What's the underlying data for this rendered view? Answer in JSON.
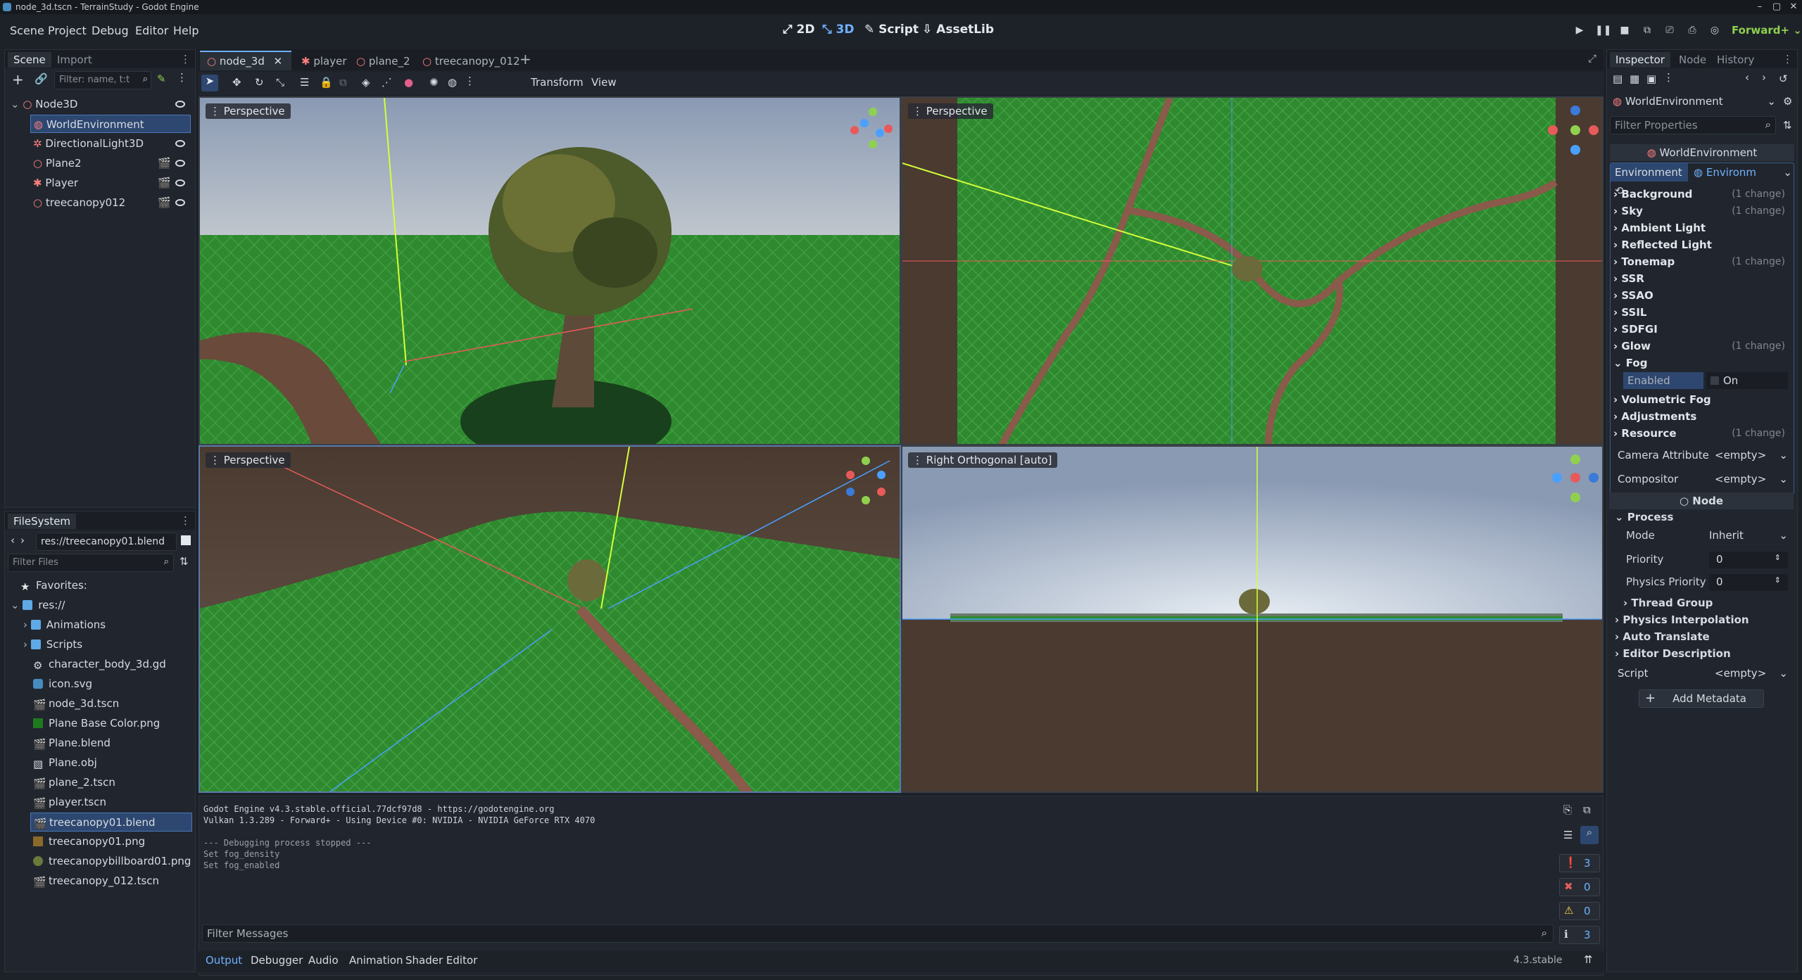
{
  "window": {
    "title": "node_3d.tscn - TerrainStudy - Godot Engine"
  },
  "menubar": {
    "items": [
      "Scene",
      "Project",
      "Debug",
      "Editor",
      "Help"
    ],
    "workspaces": [
      "2D",
      "3D",
      "Script",
      "AssetLib"
    ],
    "renderer": "Forward+"
  },
  "scene_dock": {
    "tabs": [
      "Scene",
      "Import"
    ],
    "filter_placeholder": "Filter: name, t:t",
    "nodes": [
      {
        "label": "Node3D"
      },
      {
        "label": "WorldEnvironment"
      },
      {
        "label": "DirectionalLight3D"
      },
      {
        "label": "Plane2"
      },
      {
        "label": "Player"
      },
      {
        "label": "treecanopy012"
      }
    ]
  },
  "filesystem": {
    "title": "FileSystem",
    "path": "res://treecanopy01.blend",
    "filter_placeholder": "Filter Files",
    "favorites": "Favorites:",
    "root": "res://",
    "items": [
      "Animations",
      "Scripts",
      "character_body_3d.gd",
      "icon.svg",
      "node_3d.tscn",
      "Plane Base Color.png",
      "Plane.blend",
      "Plane.obj",
      "plane_2.tscn",
      "player.tscn",
      "treecanopy01.blend",
      "treecanopy01.png",
      "treecanopybillboard01.png",
      "treecanopy_012.tscn"
    ]
  },
  "editor_tabs": [
    "node_3d",
    "player",
    "plane_2",
    "treecanopy_012"
  ],
  "toolbar": {
    "transform": "Transform",
    "view": "View"
  },
  "viewports": {
    "top_left": "Perspective",
    "top_right": "Perspective",
    "bottom_left": "Perspective",
    "bottom_right": "Right Orthogonal [auto]"
  },
  "output": {
    "lines": [
      "Godot Engine v4.3.stable.official.77dcf97d8 - https://godotengine.org",
      "Vulkan 1.3.289 - Forward+ - Using Device #0: NVIDIA - NVIDIA GeForce RTX 4070",
      "",
      "--- Debugging process stopped ---",
      "Set fog_density",
      "Set fog_enabled"
    ],
    "filter_placeholder": "Filter Messages",
    "counts": [
      "3",
      "0",
      "0",
      "3"
    ],
    "bottom_tabs": [
      "Output",
      "Debugger",
      "Audio",
      "Animation",
      "Shader Editor"
    ],
    "version": "4.3.stable"
  },
  "inspector": {
    "tabs": [
      "Inspector",
      "Node",
      "History"
    ],
    "object": "WorldEnvironment",
    "filter_placeholder": "Filter Properties",
    "header": "WorldEnvironment",
    "env_label": "Environment",
    "env_value": "Environm",
    "sections": [
      {
        "name": "Background",
        "change": "(1 change)"
      },
      {
        "name": "Sky",
        "change": "(1 change)"
      },
      {
        "name": "Ambient Light",
        "change": ""
      },
      {
        "name": "Reflected Light",
        "change": ""
      },
      {
        "name": "Tonemap",
        "change": "(1 change)"
      },
      {
        "name": "SSR",
        "change": ""
      },
      {
        "name": "SSAO",
        "change": ""
      },
      {
        "name": "SSIL",
        "change": ""
      },
      {
        "name": "SDFGI",
        "change": ""
      },
      {
        "name": "Glow",
        "change": "(1 change)"
      },
      {
        "name": "Fog",
        "change": ""
      }
    ],
    "fog_enabled_label": "Enabled",
    "fog_enabled_value": "On",
    "sections2": [
      {
        "name": "Volumetric Fog",
        "change": ""
      },
      {
        "name": "Adjustments",
        "change": ""
      },
      {
        "name": "Resource",
        "change": "(1 change)"
      }
    ],
    "camera_attr": "Camera Attribute",
    "compositor": "Compositor",
    "empty": "<empty>",
    "node_header": "Node",
    "process": "Process",
    "mode_label": "Mode",
    "mode_value": "Inherit",
    "priority_label": "Priority",
    "priority_value": "0",
    "physics_priority_label": "Physics Priority",
    "physics_priority_value": "0",
    "thread_group": "Thread Group",
    "physics_interp": "Physics Interpolation",
    "auto_translate": "Auto Translate",
    "editor_desc": "Editor Description",
    "script_label": "Script",
    "add_metadata": "Add Metadata"
  }
}
